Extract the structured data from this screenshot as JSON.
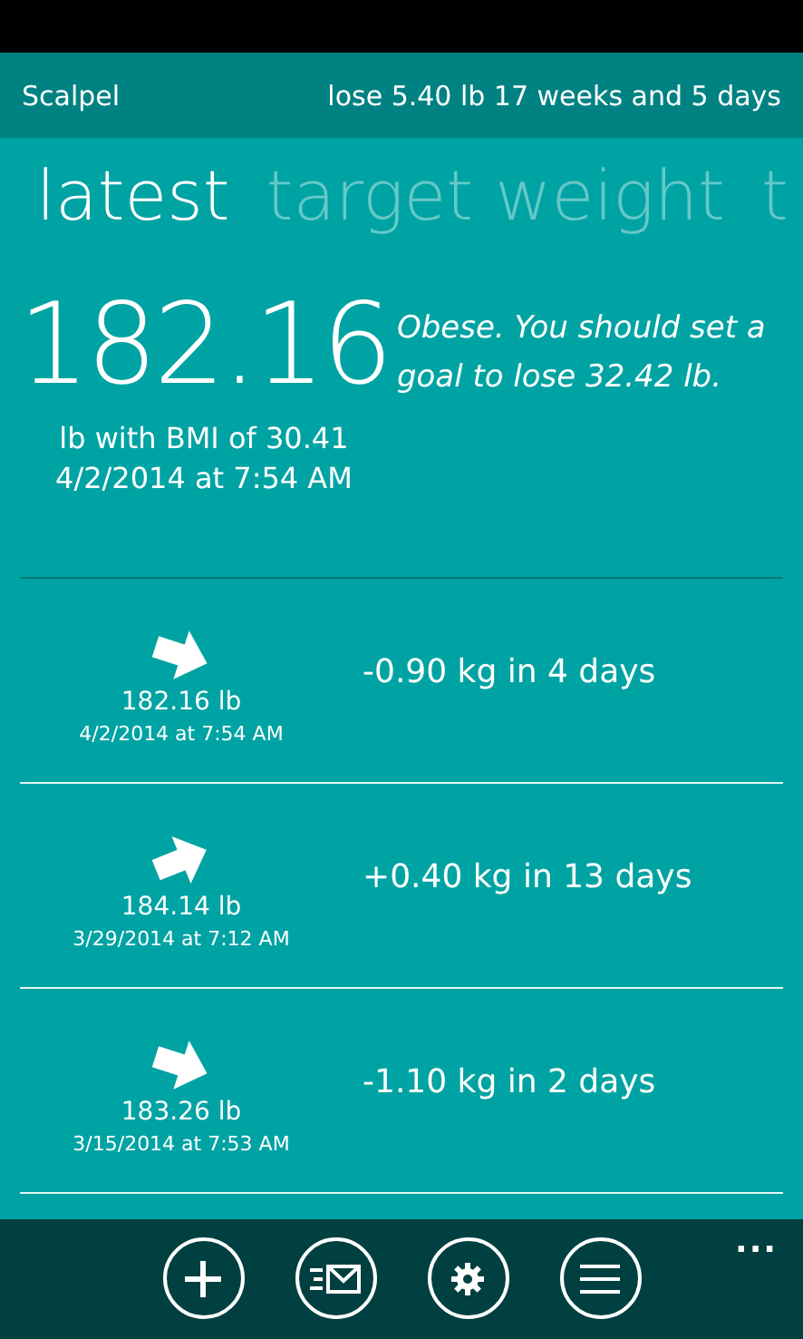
{
  "header": {
    "app_name": "Scalpel",
    "goal_summary": "lose 5.40 lb 17 weeks and 5 days"
  },
  "tabs": [
    {
      "label": "latest",
      "selected": true
    },
    {
      "label": "target weight",
      "selected": false
    },
    {
      "label": "t",
      "selected": false
    }
  ],
  "latest": {
    "weight": "182.16",
    "bmi_line": "lb with BMI of 30.41",
    "date": "4/2/2014 at 7:54 AM",
    "advice": "Obese. You should set a goal to lose 32.42 lb."
  },
  "entries": [
    {
      "kind": "down",
      "weight": "182.16 lb",
      "date": "4/2/2014 at 7:54 AM",
      "change": "-0.90 kg in 4 days"
    },
    {
      "kind": "up",
      "weight": "184.14 lb",
      "date": "3/29/2014 at 7:12 AM",
      "change": "+0.40 kg in 13 days"
    },
    {
      "kind": "down",
      "weight": "183.26 lb",
      "date": "3/15/2014 at 7:53 AM",
      "change": "-1.10 kg in 2 days"
    }
  ],
  "app_bar": {
    "buttons": [
      {
        "kind": "add"
      },
      {
        "kind": "mail"
      },
      {
        "kind": "settings"
      },
      {
        "kind": "list"
      }
    ],
    "more": "..."
  }
}
